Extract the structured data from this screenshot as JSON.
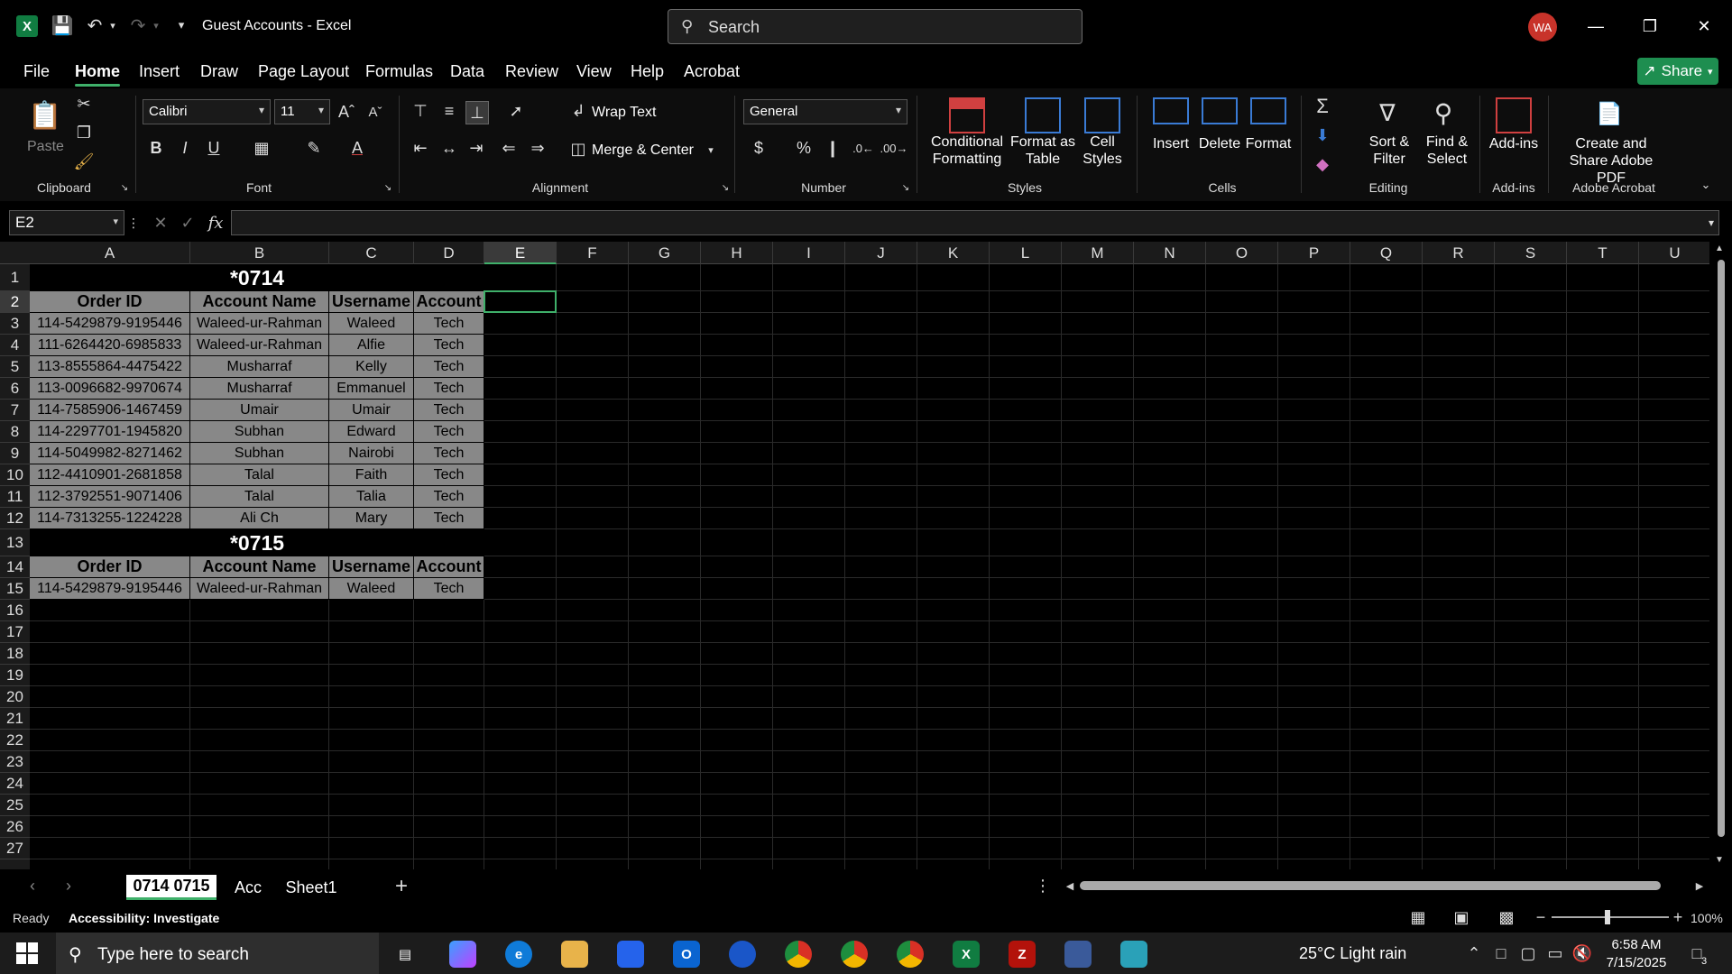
{
  "window": {
    "title": "Guest Accounts - Excel",
    "user_initials": "WA"
  },
  "search": {
    "placeholder": "Search"
  },
  "menu": {
    "items": [
      "File",
      "Home",
      "Insert",
      "Draw",
      "Page Layout",
      "Formulas",
      "Data",
      "Review",
      "View",
      "Help",
      "Acrobat"
    ],
    "active": "Home",
    "share_label": "Share"
  },
  "ribbon": {
    "clipboard": {
      "paste": "Paste",
      "group": "Clipboard"
    },
    "font": {
      "name": "Calibri",
      "size": "11",
      "group": "Font"
    },
    "alignment": {
      "wrap": "Wrap Text",
      "merge": "Merge & Center",
      "group": "Alignment"
    },
    "number": {
      "format": "General",
      "group": "Number"
    },
    "styles": {
      "conditional": "Conditional Formatting",
      "table": "Format as Table",
      "cell": "Cell Styles",
      "group": "Styles"
    },
    "cells": {
      "insert": "Insert",
      "delete": "Delete",
      "format": "Format",
      "group": "Cells"
    },
    "editing": {
      "sort": "Sort & Filter",
      "find": "Find & Select",
      "group": "Editing"
    },
    "addins": {
      "label": "Add-ins",
      "group": "Add-ins"
    },
    "acrobat": {
      "label": "Create and Share Adobe PDF",
      "group": "Adobe Acrobat"
    }
  },
  "formula_bar": {
    "name_box": "E2",
    "fx": "fx",
    "content": ""
  },
  "columns": [
    "A",
    "B",
    "C",
    "D",
    "E",
    "F",
    "G",
    "H",
    "I",
    "J",
    "K",
    "L",
    "M",
    "N",
    "O",
    "P",
    "Q",
    "R",
    "S",
    "T",
    "U"
  ],
  "selected_column": "E",
  "selected_row": "2",
  "rows": [
    "1",
    "2",
    "3",
    "4",
    "5",
    "6",
    "7",
    "8",
    "9",
    "10",
    "11",
    "12",
    "13",
    "14",
    "15",
    "16",
    "17",
    "18",
    "19",
    "20",
    "21",
    "22",
    "23",
    "24",
    "25",
    "26",
    "27"
  ],
  "sheet": {
    "block1": {
      "title": "*0714",
      "headers": [
        "Order ID",
        "Account Name",
        "Username",
        "Account"
      ],
      "rows": [
        [
          "114-5429879-9195446",
          "Waleed-ur-Rahman",
          "Waleed",
          "Tech"
        ],
        [
          "111-6264420-6985833",
          "Waleed-ur-Rahman",
          "Alfie",
          "Tech"
        ],
        [
          "113-8555864-4475422",
          "Musharraf",
          "Kelly",
          "Tech"
        ],
        [
          "113-0096682-9970674",
          "Musharraf",
          "Emmanuel",
          "Tech"
        ],
        [
          "114-7585906-1467459",
          "Umair",
          "Umair",
          "Tech"
        ],
        [
          "114-2297701-1945820",
          "Subhan",
          "Edward",
          "Tech"
        ],
        [
          "114-5049982-8271462",
          "Subhan",
          "Nairobi",
          "Tech"
        ],
        [
          "112-4410901-2681858",
          "Talal",
          "Faith",
          "Tech"
        ],
        [
          "112-3792551-9071406",
          "Talal",
          "Talia",
          "Tech"
        ],
        [
          "114-7313255-1224228",
          "Ali Ch",
          "Mary",
          "Tech"
        ]
      ]
    },
    "block2": {
      "title": "*0715",
      "headers": [
        "Order ID",
        "Account Name",
        "Username",
        "Account"
      ],
      "rows": [
        [
          "114-5429879-9195446",
          "Waleed-ur-Rahman",
          "Waleed",
          "Tech"
        ]
      ]
    }
  },
  "tabs": {
    "items": [
      "0714 0715",
      "Acc",
      "Sheet1"
    ],
    "active": "0714 0715"
  },
  "status": {
    "ready": "Ready",
    "accessibility": "Accessibility: Investigate",
    "zoom": "100%"
  },
  "taskbar": {
    "search_placeholder": "Type here to search",
    "weather": "25°C  Light rain",
    "time": "6:58 AM",
    "date": "7/15/2025",
    "notifications": "3"
  }
}
